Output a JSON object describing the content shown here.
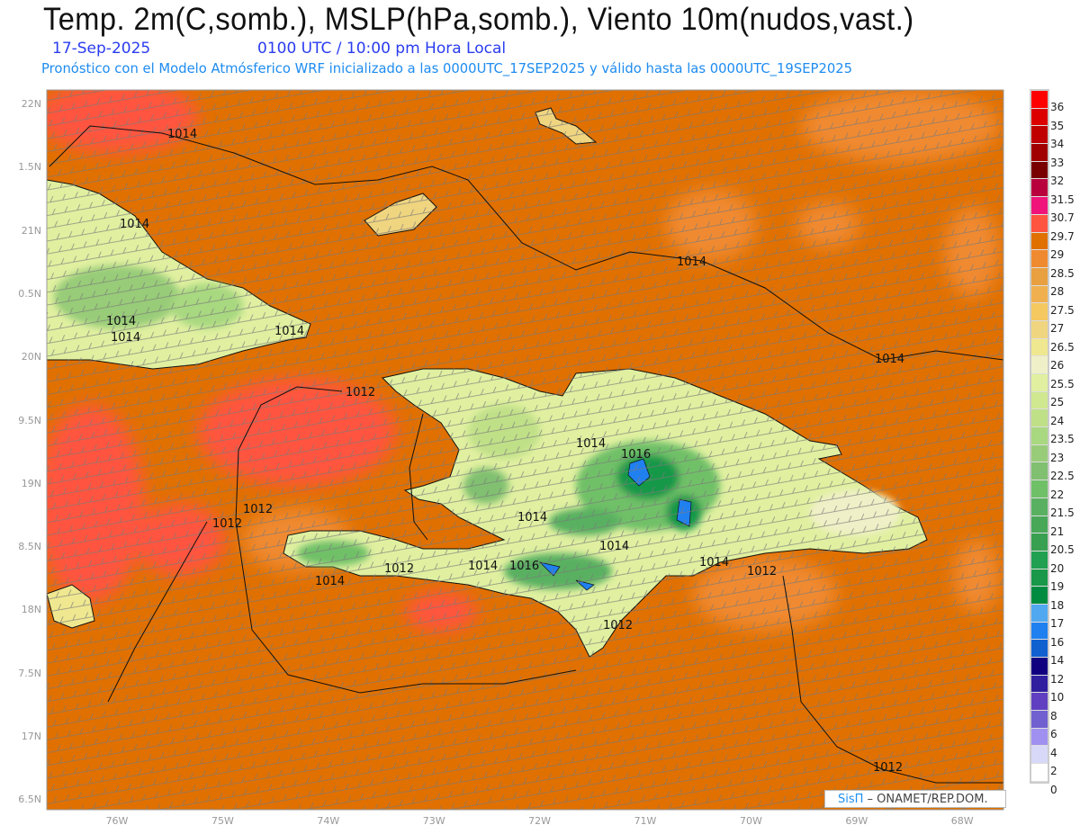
{
  "header": {
    "title": "Temp. 2m(C,somb.), MSLP(hPa,somb.), Viento 10m(nudos,vast.)",
    "date": "17-Sep-2025",
    "time": "0100 UTC / 10:00 pm Hora Local",
    "subtitle": "Pronóstico con el Modelo Atmósferico WRF inicializado a las 0000UTC_17SEP2025 y válido hasta las  0000UTC_19SEP2025"
  },
  "axes": {
    "lat_labels": [
      "22N",
      "1.5N",
      "21N",
      "0.5N",
      "20N",
      "9.5N",
      "19N",
      "8.5N",
      "18N",
      "7.5N",
      "17N",
      "6.5N"
    ],
    "lon_labels": [
      "76W",
      "75W",
      "74W",
      "73W",
      "72W",
      "71W",
      "70W",
      "69W",
      "68W"
    ]
  },
  "legend": {
    "labels": [
      "36",
      "35",
      "34",
      "33",
      "32",
      "31.5",
      "30.7",
      "29.7",
      "29",
      "28.5",
      "28",
      "27.5",
      "27",
      "26.5",
      "26",
      "25.5",
      "25",
      "24",
      "23.5",
      "23",
      "22.5",
      "22",
      "21.5",
      "21",
      "20.5",
      "20",
      "19",
      "18",
      "17",
      "16",
      "14",
      "12",
      "10",
      "8",
      "6",
      "4",
      "2",
      "0"
    ],
    "colors": [
      "#ff0000",
      "#dc0000",
      "#c00000",
      "#a00000",
      "#780000",
      "#b8003c",
      "#f0147a",
      "#ff5540",
      "#e07000",
      "#f08a30",
      "#e8a040",
      "#f0b050",
      "#f5c860",
      "#f0d580",
      "#f0e890",
      "#f0f0c8",
      "#e0f0a0",
      "#d0e890",
      "#c0e088",
      "#a8d880",
      "#98cc78",
      "#80c070",
      "#70c068",
      "#58b060",
      "#48a858",
      "#38a050",
      "#20a050",
      "#189848",
      "#008c40",
      "#50a8f0",
      "#2080f0",
      "#1060d0",
      "#100080",
      "#3020a0",
      "#6040c0",
      "#7060d0",
      "#a090f0",
      "#d8d8f8",
      "#ffffff"
    ]
  },
  "contours": {
    "labels": [
      "1014",
      "1014",
      "1014",
      "1014",
      "1014",
      "1014",
      "1014",
      "1012",
      "1012",
      "1012",
      "1014",
      "1016",
      "1014",
      "1014",
      "1014",
      "1012",
      "1014",
      "1016",
      "1012",
      "1014",
      "1012",
      "1012"
    ]
  },
  "credit": {
    "brand": "SisΠ",
    "text": " –  ONAMET/REP.DOM."
  }
}
